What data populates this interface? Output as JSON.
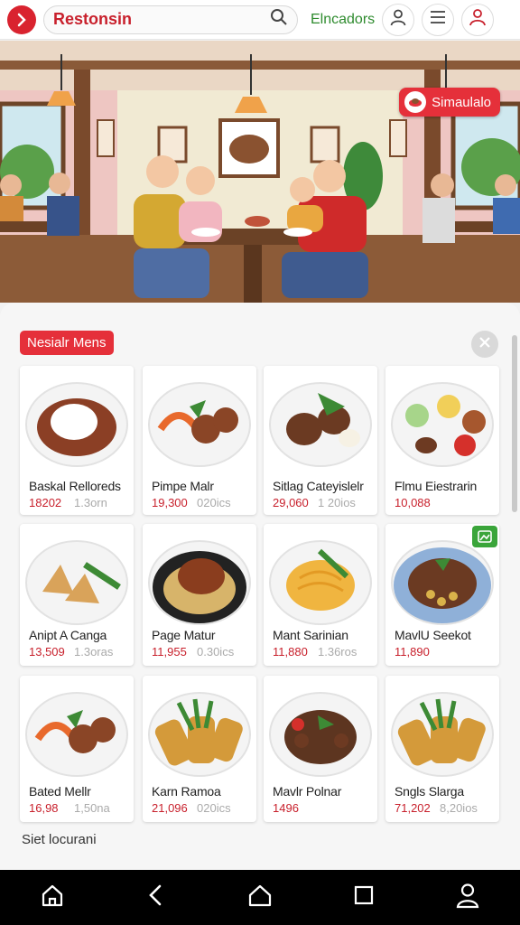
{
  "header": {
    "search_text": "Restonsin",
    "locations_label": "Elncadors"
  },
  "hero": {
    "simulate_label": "Simaulalo"
  },
  "panel": {
    "title": "Nesialr Mens",
    "footer": "Siet locurani"
  },
  "menu_items": [
    {
      "name": "Baskal Relloreds",
      "price": "18202",
      "sub": "1.3orn",
      "dish": "rice-curry"
    },
    {
      "name": "Pimpe Malr",
      "price": "19,300",
      "sub": "020ics",
      "dish": "meatballs-veg"
    },
    {
      "name": "Sitlag Cateyislelr",
      "price": "29,060",
      "sub": "1 20ios",
      "dish": "grilled-meat"
    },
    {
      "name": "Flmu Eiestrarin",
      "price": "10,088",
      "sub": "",
      "dish": "dips-platter"
    },
    {
      "name": "Anipt A Canga",
      "price": "13,509",
      "sub": "1.3oras",
      "dish": "samosa-beans"
    },
    {
      "name": "Page Matur",
      "price": "11,955",
      "sub": "0.30ics",
      "dish": "roast-chicken"
    },
    {
      "name": "Mant Sarinian",
      "price": "11,880",
      "sub": "1.36ros",
      "dish": "noodles"
    },
    {
      "name": "MavlU Seekot",
      "price": "11,890",
      "sub": "",
      "dish": "beans-stew"
    },
    {
      "name": "Bated Mellr",
      "price": "16,98",
      "sub": "1,50na",
      "dish": "meatballs-veg"
    },
    {
      "name": "Karn Ramoa",
      "price": "21,096",
      "sub": "020ics",
      "dish": "fried-rolls"
    },
    {
      "name": "Mavlr Polnar",
      "price": "1496",
      "sub": "",
      "dish": "spaghetti-meat"
    },
    {
      "name": "Sngls Slarga",
      "price": "71,202",
      "sub": "8,20ios",
      "dish": "fried-rolls"
    }
  ],
  "colors": {
    "brand_red": "#e5303a",
    "price_red": "#c8202c",
    "locations_green": "#2e8b2e"
  },
  "icons": {
    "logo": "arrow-right-circle-icon",
    "search": "search-icon",
    "profile": "user-icon",
    "menu": "hamburger-icon",
    "account": "user-outline-icon",
    "close": "close-icon",
    "badge": "image-icon",
    "nav": [
      "home-icon",
      "back-icon",
      "home-outline-icon",
      "recents-icon",
      "user-icon"
    ]
  }
}
